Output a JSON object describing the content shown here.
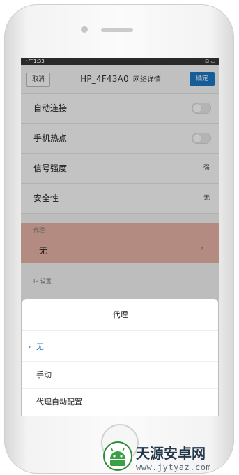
{
  "status_bar": {
    "time": "下午1:33",
    "icons": "⊡ ▭"
  },
  "nav": {
    "cancel_label": "取消",
    "title": "HP_4F43A0",
    "subtitle": "网络详情",
    "confirm_label": "确定"
  },
  "settings": {
    "auto_connect": {
      "label": "自动连接",
      "enabled": false
    },
    "hotspot": {
      "label": "手机热点",
      "enabled": false
    },
    "signal": {
      "label": "信号强度",
      "value": "强"
    },
    "security": {
      "label": "安全性",
      "value": "无"
    }
  },
  "proxy_section": {
    "label": "代理",
    "value": "无"
  },
  "ip_section": {
    "label": "IP 设置"
  },
  "sheet": {
    "title": "代理",
    "selected_marker": "›",
    "options": [
      "无",
      "手动",
      "代理自动配置"
    ]
  },
  "watermark": {
    "text": "天源安卓网",
    "url": "www.jytyaz.com"
  },
  "colors": {
    "accent": "#1b78c4",
    "highlight": "#e7b3a6",
    "check": "#2a79c9"
  }
}
